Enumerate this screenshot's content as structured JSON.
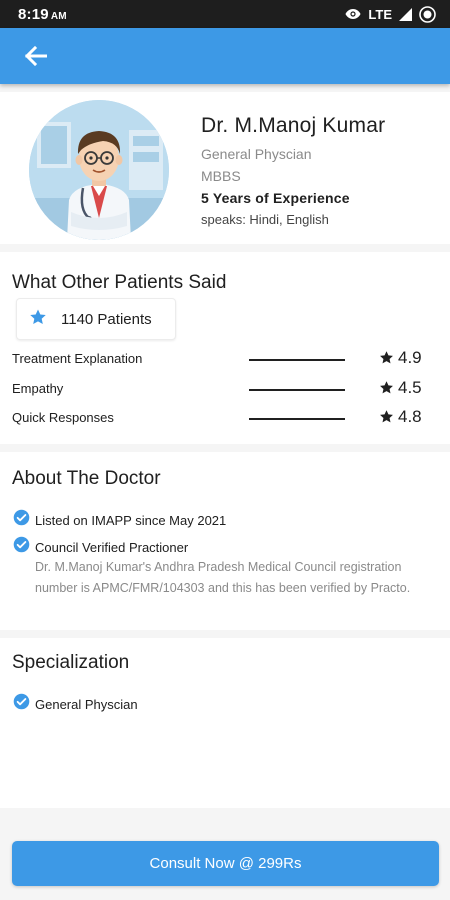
{
  "status_bar": {
    "time": "8:19",
    "ampm": "AM",
    "network": "LTE",
    "icons": [
      "eye-icon",
      "lte-signal-icon",
      "battery-icon"
    ]
  },
  "app_bar": {
    "back_icon": "arrow-left-icon",
    "color": "#3d99e6"
  },
  "doctor": {
    "name": "Dr. M.Manoj Kumar",
    "specialty": "General Physcian",
    "degree": "MBBS",
    "experience": "5 Years of Experience",
    "languages": "speaks: Hindi, English"
  },
  "reviews": {
    "title": "What Other Patients Said",
    "patients_count": "1140 Patients",
    "items": [
      {
        "label": "Treatment Explanation",
        "value": "4.9"
      },
      {
        "label": "Empathy",
        "value": "4.5"
      },
      {
        "label": "Quick Responses",
        "value": "4.8"
      }
    ]
  },
  "about": {
    "title": "About The Doctor",
    "listed": "Listed on IMAPP since May 2021",
    "verified": "Council Verified Practioner",
    "description": "Dr. M.Manoj Kumar's Andhra Pradesh Medical Council registration number is APMC/FMR/104303 and this has been verified by Practo."
  },
  "specialization": {
    "title": "Specialization",
    "items": [
      "General Physcian"
    ]
  },
  "consult": {
    "label": "Consult Now @ 299Rs"
  },
  "colors": {
    "accent": "#3d99e6",
    "status_bar": "#1e1e1e",
    "check": "#3d99e6"
  }
}
